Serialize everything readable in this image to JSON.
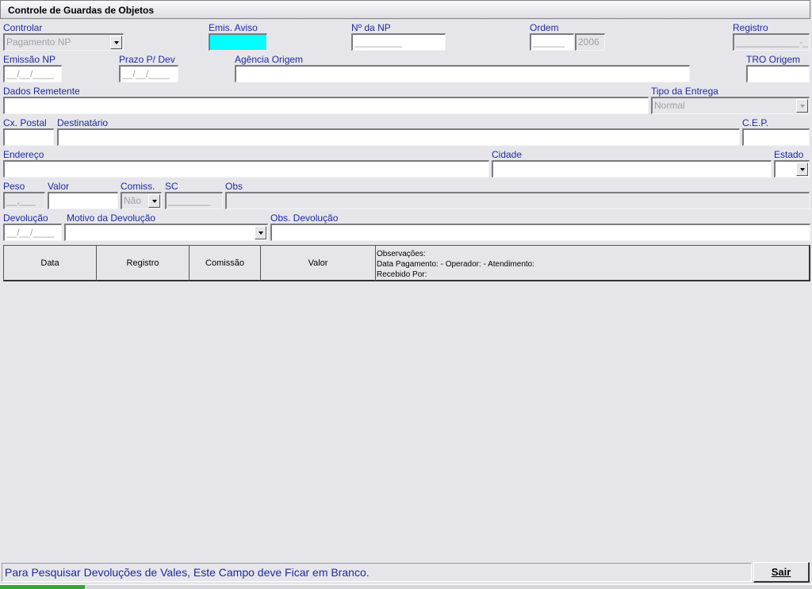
{
  "window": {
    "title": "Controle de Guardas de Objetos"
  },
  "labels": {
    "controlar": "Controlar",
    "emis_aviso": "Emis. Aviso",
    "num_np": "Nº da NP",
    "ordem": "Ordem",
    "registro": "Registro",
    "emissao_np": "Emissão NP",
    "prazo_dev": "Prazo P/ Dev",
    "agencia_origem": "Agência Origem",
    "tro_origem": "TRO Origem",
    "dados_remetente": "Dados Remetente",
    "tipo_entrega": "Tipo da Entrega",
    "cx_postal": "Cx. Postal",
    "destinatario": "Destinatário",
    "cep": "C.E.P.",
    "endereco": "Endereço",
    "cidade": "Cidade",
    "estado": "Estado",
    "peso": "Peso",
    "valor": "Valor",
    "comiss": "Comiss.",
    "sc": "SC",
    "obs": "Obs",
    "devolucao": "Devolução",
    "motivo_devolucao": "Motivo da Devolução",
    "obs_devolucao": "Obs. Devolução"
  },
  "fields": {
    "controlar": "Pagamento NP",
    "emis_aviso": "",
    "num_np": "_________",
    "ordem": "______",
    "ordem_ano": "2006",
    "registro": "____________-_",
    "emissao_np": "__/__/____",
    "prazo_dev": "__/__/____",
    "agencia_origem": "",
    "tro_origem": "",
    "dados_remetente": "",
    "tipo_entrega": "Normal",
    "cx_postal": "",
    "destinatario": "",
    "cep": "",
    "endereco": "",
    "cidade": "",
    "estado": "",
    "peso": "__,___",
    "valor": "",
    "comiss": "Não",
    "sc": "________",
    "obs": "",
    "devolucao": "__/__/____",
    "motivo_devolucao": "",
    "obs_devolucao": ""
  },
  "grid": {
    "columns": [
      "Data",
      "Registro",
      "Comissão",
      "Valor"
    ],
    "obs_line1": "Observações:",
    "obs_line2": "Data Pagamento:  -  Operador:  -  Atendimento:",
    "obs_line3": "Recebido Por:"
  },
  "status": {
    "message": "Para Pesquisar Devoluções de Vales, Este Campo deve Ficar em Branco."
  },
  "buttons": {
    "sair": "Sair"
  },
  "colors": {
    "label": "#1c2aa0",
    "highlight": "#00ffff",
    "background": "#e6e6ea"
  }
}
